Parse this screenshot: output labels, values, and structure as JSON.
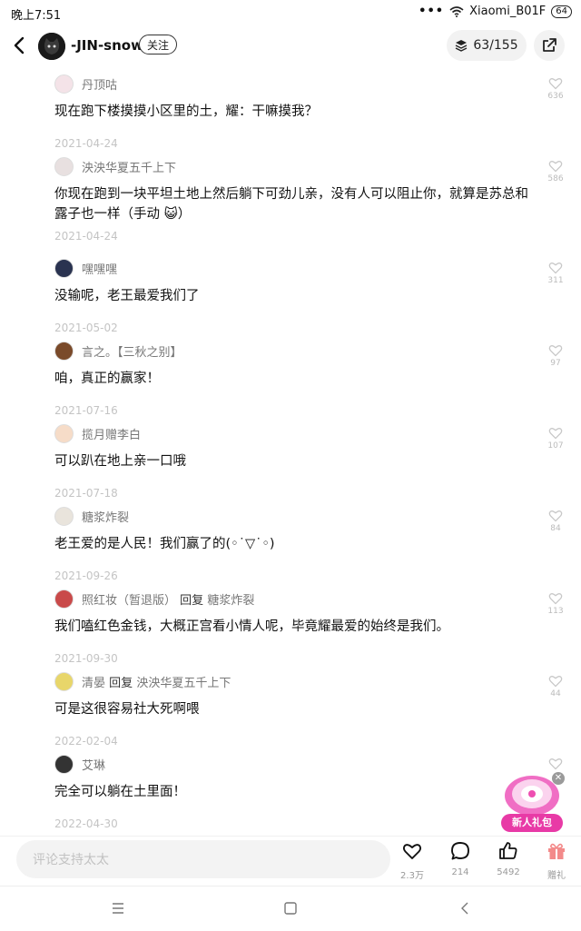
{
  "status": {
    "time": "晚上7:51",
    "carrier": "Xiaomi_B01F",
    "battery": "64",
    "dots": "•••"
  },
  "header": {
    "name": "-JIN-snow",
    "follow_label": "关注",
    "counter": "63/155"
  },
  "comments": [
    {
      "user": "丹顶咕",
      "reply_label": "",
      "reply_to": "",
      "text": "现在跑下楼摸摸小区里的土，耀：干嘛摸我？",
      "date": "2021-04-24",
      "likes": "636",
      "avatar_color": "#f4e3e8"
    },
    {
      "user": "泱泱华夏五千上下",
      "reply_label": "",
      "reply_to": "",
      "text": "你现在跑到一块平坦土地上然后躺下可劲儿亲，没有人可以阻止你，就算是苏总和露子也一样（手动 😺）",
      "date": "2021-04-24",
      "likes": "586",
      "avatar_color": "#e8e0e0"
    },
    {
      "user": "嘿嘿嘿",
      "reply_label": "",
      "reply_to": "",
      "text": "没输呢，老王最爱我们了",
      "date": "2021-05-02",
      "likes": "311",
      "avatar_color": "#2a3350"
    },
    {
      "user": "言之。【三秋之别】",
      "reply_label": "",
      "reply_to": "",
      "text": "咱，真正的赢家！",
      "date": "2021-07-16",
      "likes": "97",
      "avatar_color": "#7a4a2a"
    },
    {
      "user": "揽月赠李白",
      "reply_label": "",
      "reply_to": "",
      "text": "可以趴在地上亲一口哦",
      "date": "2021-07-18",
      "likes": "107",
      "avatar_color": "#f6dcc8"
    },
    {
      "user": "糖浆炸裂",
      "reply_label": "",
      "reply_to": "",
      "text": "老王爱的是人民！我们赢了的(◦˙▽˙◦)",
      "date": "2021-09-26",
      "likes": "84",
      "avatar_color": "#e9e4dc"
    },
    {
      "user": "照红妆（暂退版）",
      "reply_label": "回复",
      "reply_to": "糖浆炸裂",
      "text": "我们嗑红色金钱，大概正宫看小情人呢，毕竟耀最爱的始终是我们。",
      "date": "2021-09-30",
      "likes": "113",
      "avatar_color": "#c94a4a"
    },
    {
      "user": "清晏",
      "reply_label": "回复",
      "reply_to": "泱泱华夏五千上下",
      "text": "可是这很容易社大死啊喂",
      "date": "2022-02-04",
      "likes": "44",
      "avatar_color": "#e8d66a"
    },
    {
      "user": "艾琳",
      "reply_label": "",
      "reply_to": "",
      "text": "完全可以躺在土里面！",
      "date": "2022-04-30",
      "likes": "",
      "avatar_color": "#333333"
    }
  ],
  "gift_promo": {
    "label": "新人礼包"
  },
  "bottom": {
    "placeholder": "评论支持太太",
    "like_count": "2.3万",
    "comment_count": "214",
    "thumb_count": "5492",
    "gift_label": "赠礼"
  },
  "colors": {
    "accent_pink": "#e83aa6",
    "gift_red": "#f06a6a"
  }
}
